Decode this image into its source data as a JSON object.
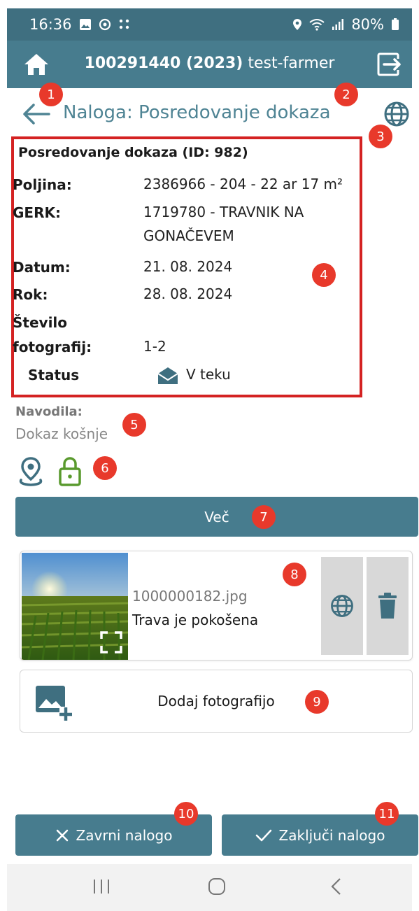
{
  "status_bar": {
    "time": "16:36",
    "battery": "80%"
  },
  "header": {
    "id": "100291440 (2023)",
    "user": "test-farmer"
  },
  "title_row": {
    "title": "Naloga: Posredovanje dokaza"
  },
  "details": {
    "title": "Posredovanje dokaza (ID: 982)",
    "rows": [
      {
        "label": "Poljina:",
        "value": "2386966 - 204 - 22 ar 17 m²"
      },
      {
        "label": "GERK:",
        "value_line1": "1719780 - TRAVNIK NA",
        "value_line2": "GONAČEVEM"
      },
      {
        "label": "Datum:",
        "value": "21. 08. 2024"
      },
      {
        "label": "Rok:",
        "value": "28. 08. 2024"
      },
      {
        "label_line1": "Število",
        "label_line2": "fotografij:",
        "value": "1-2"
      },
      {
        "label": "Status",
        "value": "V teku"
      }
    ]
  },
  "instructions": {
    "label": "Navodila:",
    "text": "Dokaz košnje"
  },
  "more_button": {
    "label": "Več"
  },
  "photo": {
    "filename": "1000000182.jpg",
    "caption": "Trava je pokošena"
  },
  "add_photo": {
    "label": "Dodaj fotografijo"
  },
  "actions": {
    "cancel_label": "Zavrni nalogo",
    "finish_label": "Zaključi nalogo"
  },
  "markers": [
    "1",
    "2",
    "3",
    "4",
    "5",
    "6",
    "7",
    "8",
    "9",
    "10",
    "11"
  ],
  "colors": {
    "primary": "#477c8e",
    "status_bar": "#3f6f80",
    "marker": "#e8392b",
    "highlight_border": "#d42222",
    "lock_green": "#5a9a2e"
  }
}
